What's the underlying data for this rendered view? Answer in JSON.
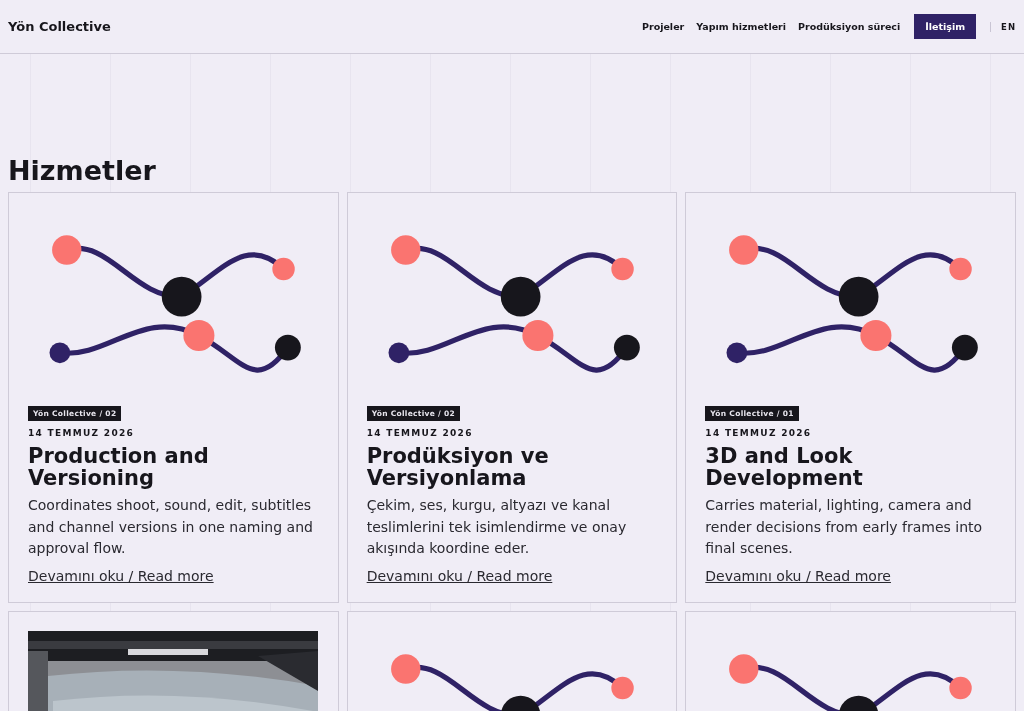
{
  "header": {
    "logo": "Yön Collective",
    "nav": [
      {
        "label": "Projeler",
        "kind": "link"
      },
      {
        "label": "Yapım hizmetleri",
        "kind": "link"
      },
      {
        "label": "Prodüksiyon süreci",
        "kind": "link"
      },
      {
        "label": "İletişim",
        "kind": "button"
      }
    ],
    "language": "EN"
  },
  "section": {
    "title": "Hizmetler"
  },
  "cards": [
    {
      "kind": "diagram",
      "tag": "Yön Collective / 02",
      "date": "14 TEMMUZ 2026",
      "title": "Production and Versioning",
      "text": "Coordinates shoot, sound, edit, subtitles and channel versions in one naming and approval flow.",
      "link": "Devamını oku / Read more"
    },
    {
      "kind": "diagram",
      "tag": "Yön Collective / 02",
      "date": "14 TEMMUZ 2026",
      "title": "Prodüksiyon ve Versiyonlama",
      "text": "Çekim, ses, kurgu, altyazı ve kanal teslimlerini tek isimlendirme ve onay akışında koordine eder.",
      "link": "Devamını oku / Read more"
    },
    {
      "kind": "diagram",
      "tag": "Yön Collective / 01",
      "date": "14 TEMMUZ 2026",
      "title": "3D and Look Development",
      "text": "Carries material, lighting, camera and render decisions from early frames into final scenes.",
      "link": "Devamını oku / Read more"
    },
    {
      "kind": "picture"
    },
    {
      "kind": "diagram"
    },
    {
      "kind": "diagram"
    }
  ]
}
